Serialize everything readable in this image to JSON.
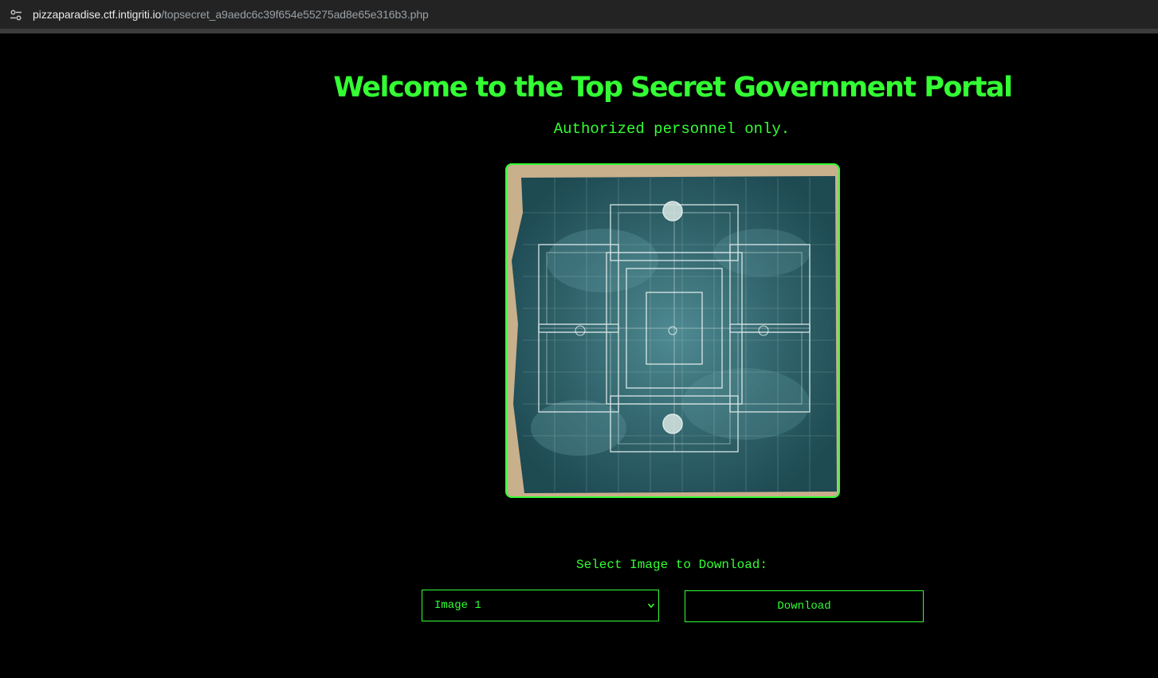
{
  "browser": {
    "url_host": "pizzaparadise.ctf.intigriti.io",
    "url_path": "/topsecret_a9aedc6c39f654e55275ad8e65e316b3.php",
    "site_info_icon": "tune-icon"
  },
  "page": {
    "title": "Welcome to the Top Secret Government Portal",
    "subtitle": "Authorized personnel only.",
    "image": {
      "description_icon": "blueprint-image"
    },
    "download": {
      "label": "Select Image to Download:",
      "selected_option": "Image 1",
      "button_label": "Download"
    }
  },
  "colors": {
    "accent": "#33ff33",
    "background": "#000000",
    "browser_bar": "#232323"
  }
}
